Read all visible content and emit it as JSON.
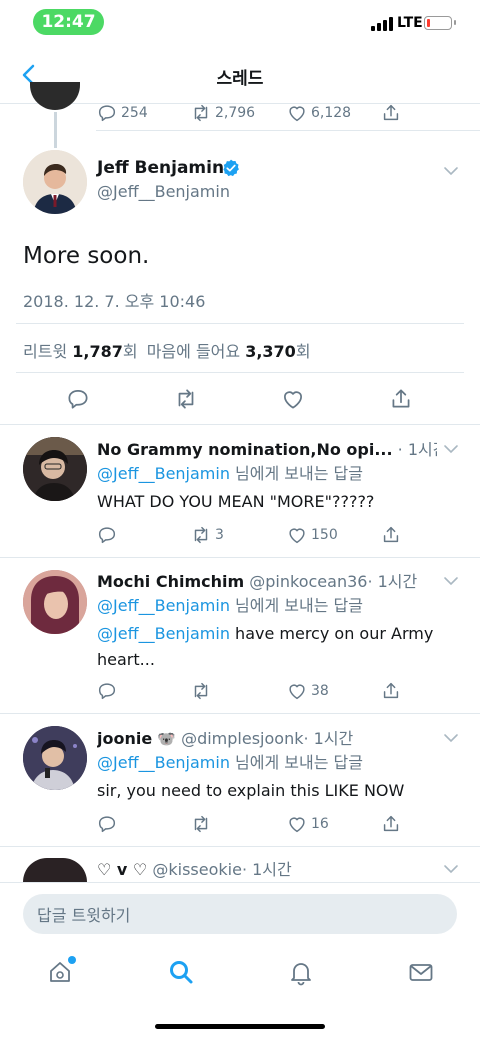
{
  "status": {
    "time": "12:47",
    "network": "LTE"
  },
  "nav": {
    "title": "스레드"
  },
  "parent_tweet": {
    "replies": "254",
    "retweets": "2,796",
    "likes": "6,128"
  },
  "main_tweet": {
    "name": "Jeff Benjamin",
    "handle": "@Jeff__Benjamin",
    "text": "More soon.",
    "timestamp": "2018. 12. 7. 오후 10:46",
    "retweet_label": "리트윗",
    "retweet_count": "1,787",
    "count_suffix_1": "회",
    "like_label": "마음에 들어요",
    "like_count": "3,370",
    "count_suffix_2": "회",
    "accent": "#1da1f2"
  },
  "replies": [
    {
      "name": "No Grammy nomination,No opi...",
      "handle": "",
      "time": "· 1시간",
      "reply_to": "@Jeff__Benjamin",
      "reply_to_suffix": " 님에게 보내는 답글",
      "text": "WHAT DO YOU MEAN \"MORE\"?????",
      "retweets": "3",
      "likes": "150"
    },
    {
      "name": "Mochi Chimchim",
      "handle": "@pinkocean36",
      "time": "· 1시간",
      "reply_to": "@Jeff__Benjamin",
      "reply_to_suffix": " 님에게 보내는 답글",
      "text_mention": "@Jeff__Benjamin",
      "text": " have mercy on our Army",
      "text_line2": "heart...",
      "retweets": "",
      "likes": "38"
    },
    {
      "name": "joonie",
      "emoji": "🐨",
      "handle": "@dimplesjoonk",
      "time": "· 1시간",
      "reply_to": "@Jeff__Benjamin",
      "reply_to_suffix": " 님에게 보내는 답글",
      "text": "sir, you need to explain this LIKE NOW",
      "retweets": "",
      "likes": "16"
    },
    {
      "name": "♡ v ♡",
      "handle": "@kisseokie",
      "time": "· 1시간"
    }
  ],
  "composer": {
    "placeholder": "답글 트윗하기"
  },
  "tabbar": {
    "items": [
      "home-icon",
      "search-icon",
      "notifications-icon",
      "messages-icon"
    ]
  }
}
